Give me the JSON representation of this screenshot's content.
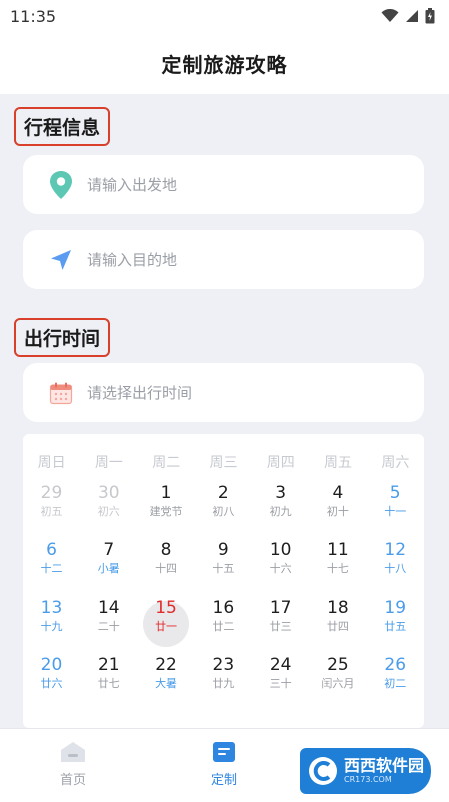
{
  "status_bar": {
    "time": "11:35"
  },
  "header": {
    "title": "定制旅游攻略"
  },
  "sections": {
    "itinerary_title": "行程信息",
    "time_title": "出行时间"
  },
  "inputs": {
    "departure_placeholder": "请输入出发地",
    "destination_placeholder": "请输入目的地",
    "date_placeholder": "请选择出行时间"
  },
  "calendar": {
    "weekdays": [
      "周日",
      "周一",
      "周二",
      "周三",
      "周四",
      "周五",
      "周六"
    ],
    "weeks": [
      [
        {
          "day": "29",
          "sub": "初五",
          "state": "gray"
        },
        {
          "day": "30",
          "sub": "初六",
          "state": "gray"
        },
        {
          "day": "1",
          "sub": "建党节",
          "state": "normal"
        },
        {
          "day": "2",
          "sub": "初八",
          "state": "normal"
        },
        {
          "day": "3",
          "sub": "初九",
          "state": "normal"
        },
        {
          "day": "4",
          "sub": "初十",
          "state": "normal"
        },
        {
          "day": "5",
          "sub": "十一",
          "state": "weekend"
        }
      ],
      [
        {
          "day": "6",
          "sub": "十二",
          "state": "weekend"
        },
        {
          "day": "7",
          "sub": "小暑",
          "state": "normal",
          "term": true
        },
        {
          "day": "8",
          "sub": "十四",
          "state": "normal"
        },
        {
          "day": "9",
          "sub": "十五",
          "state": "normal"
        },
        {
          "day": "10",
          "sub": "十六",
          "state": "normal"
        },
        {
          "day": "11",
          "sub": "十七",
          "state": "normal"
        },
        {
          "day": "12",
          "sub": "十八",
          "state": "weekend"
        }
      ],
      [
        {
          "day": "13",
          "sub": "十九",
          "state": "weekend"
        },
        {
          "day": "14",
          "sub": "二十",
          "state": "normal"
        },
        {
          "day": "15",
          "sub": "廿一",
          "state": "today"
        },
        {
          "day": "16",
          "sub": "廿二",
          "state": "normal"
        },
        {
          "day": "17",
          "sub": "廿三",
          "state": "normal"
        },
        {
          "day": "18",
          "sub": "廿四",
          "state": "normal"
        },
        {
          "day": "19",
          "sub": "廿五",
          "state": "weekend"
        }
      ],
      [
        {
          "day": "20",
          "sub": "廿六",
          "state": "weekend"
        },
        {
          "day": "21",
          "sub": "廿七",
          "state": "normal"
        },
        {
          "day": "22",
          "sub": "大暑",
          "state": "normal",
          "term": true
        },
        {
          "day": "23",
          "sub": "廿九",
          "state": "normal"
        },
        {
          "day": "24",
          "sub": "三十",
          "state": "normal"
        },
        {
          "day": "25",
          "sub": "闰六月",
          "state": "normal"
        },
        {
          "day": "26",
          "sub": "初二",
          "state": "weekend"
        }
      ]
    ]
  },
  "tabs": [
    {
      "label": "首页",
      "icon": "home-icon",
      "active": false
    },
    {
      "label": "定制",
      "icon": "list-icon",
      "active": true
    }
  ],
  "watermark": {
    "text": "西西软件园",
    "sub": "CR173.COM"
  },
  "colors": {
    "accent": "#2f86e0",
    "weekend": "#4a9ce8",
    "today": "#e22b2b",
    "highlight_border": "#d9402b",
    "location_pin": "#5cc8b4"
  }
}
